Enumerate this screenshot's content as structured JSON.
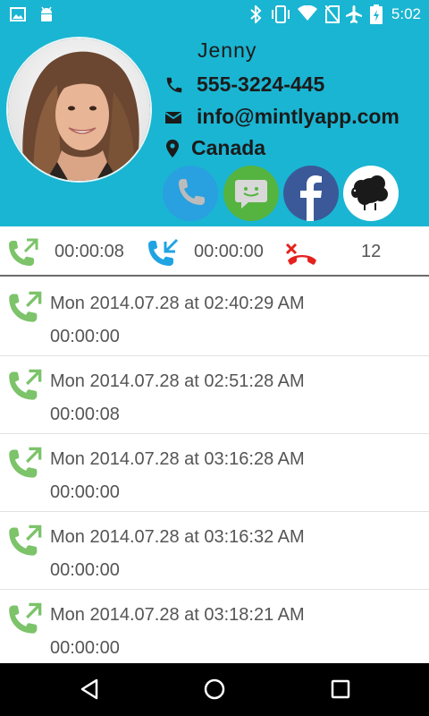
{
  "status_bar": {
    "time": "5:02",
    "left_icons": [
      "image-icon",
      "android-icon"
    ],
    "right_icons": [
      "bluetooth-icon",
      "vibrate-icon",
      "wifi-icon",
      "no-sim-icon",
      "airplane-icon",
      "battery-icon"
    ]
  },
  "contact": {
    "name": "Jenny",
    "phone": "555-3224-445",
    "email": "info@mintlyapp.com",
    "location": "Canada"
  },
  "actions": [
    "call-action-icon",
    "message-action-icon",
    "facebook-action-icon",
    "sheep-action-icon"
  ],
  "summary": {
    "outgoing_duration": "00:00:08",
    "incoming_duration": "00:00:00",
    "missed_count": "12"
  },
  "calls": [
    {
      "date": "Mon 2014.07.28 at 02:40:29 AM",
      "duration": "00:00:00"
    },
    {
      "date": "Mon 2014.07.28 at 02:51:28 AM",
      "duration": "00:00:08"
    },
    {
      "date": "Mon 2014.07.28 at 03:16:28 AM",
      "duration": "00:00:00"
    },
    {
      "date": "Mon 2014.07.28 at 03:16:32 AM",
      "duration": "00:00:00"
    },
    {
      "date": "Mon 2014.07.28 at 03:18:21 AM",
      "duration": "00:00:00"
    }
  ],
  "colors": {
    "header_bg": "#1ab5d2",
    "outgoing_green": "#7cc36a",
    "incoming_blue": "#1fa3e3",
    "missed_red": "#e5201d"
  },
  "nav": [
    "back-icon",
    "home-icon",
    "recents-icon"
  ]
}
